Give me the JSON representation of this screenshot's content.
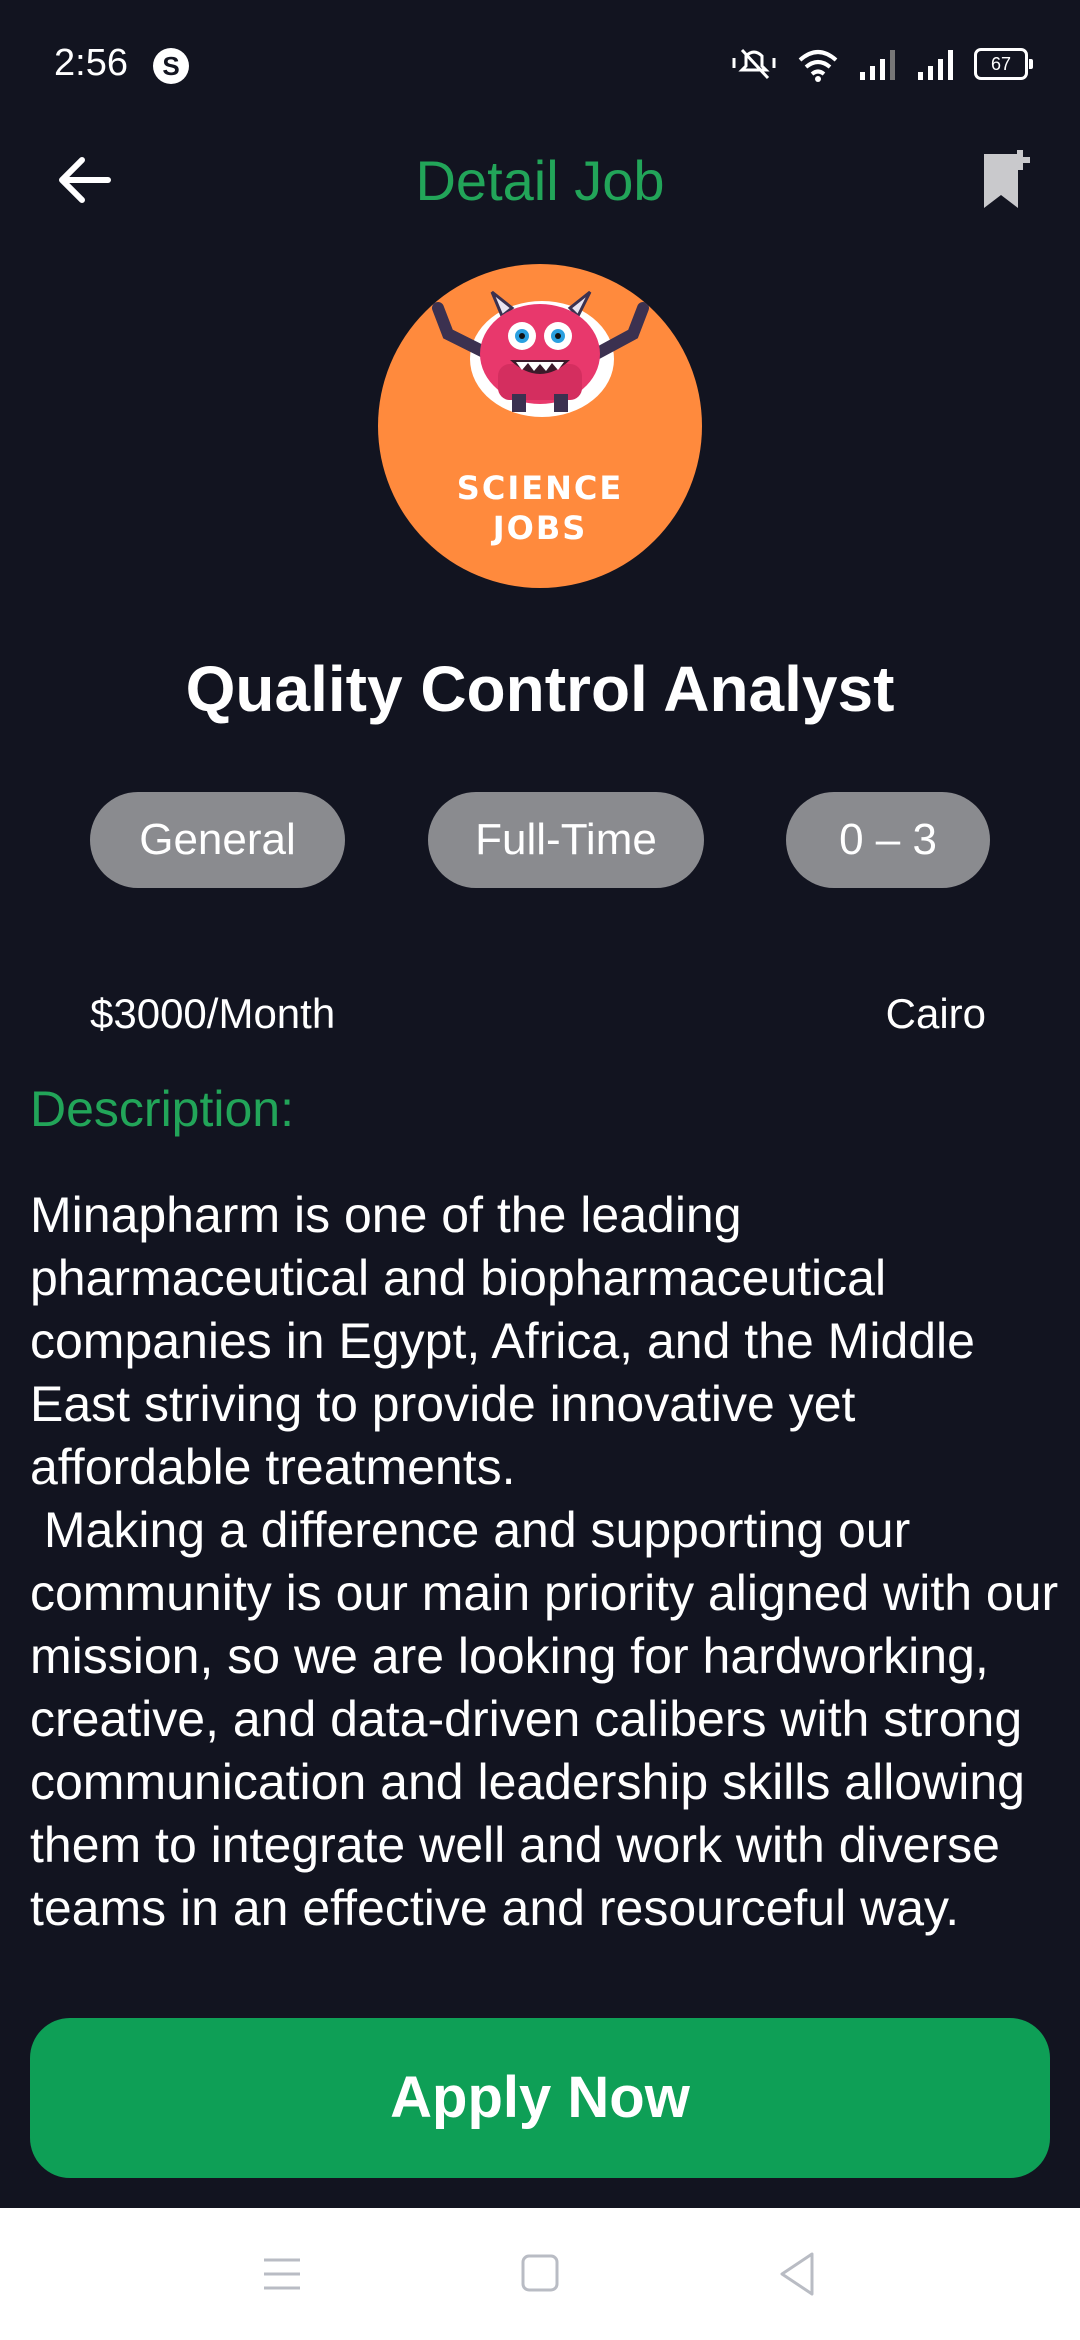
{
  "status_bar": {
    "time": "2:56",
    "app_icon_letter": "S",
    "battery": "67"
  },
  "header": {
    "title": "Detail Job"
  },
  "logo": {
    "line1": "SCIENCE",
    "line2": "JOBS"
  },
  "job": {
    "title": "Quality Control Analyst",
    "tags": [
      "General",
      "Full-Time",
      "0 – 3"
    ],
    "salary": "$3000/Month",
    "location": "Cairo"
  },
  "description": {
    "heading": "Description:",
    "text": "Minapharm is one of the leading pharmaceutical and biopharmaceutical companies in Egypt, Africa, and the Middle East striving to provide innovative yet affordable treatments.\n Making a difference and supporting our community is our main priority aligned with our mission, so we are looking for hardworking, creative, and data-driven calibers with strong communication and leadership skills allowing them to integrate well and work with diverse teams in an effective and resourceful way."
  },
  "apply_button": {
    "label": "Apply Now"
  },
  "colors": {
    "background": "#121420",
    "accent_green": "#22a559",
    "button_green": "#0e9f56",
    "chip_gray": "#8a8b8f",
    "logo_orange": "#ff8a3d"
  },
  "icons": {
    "back": "arrow-left-icon",
    "bookmark": "bookmark-add-icon",
    "nav_menu": "menu-icon",
    "nav_home": "square-home-icon",
    "nav_back": "triangle-back-icon"
  }
}
